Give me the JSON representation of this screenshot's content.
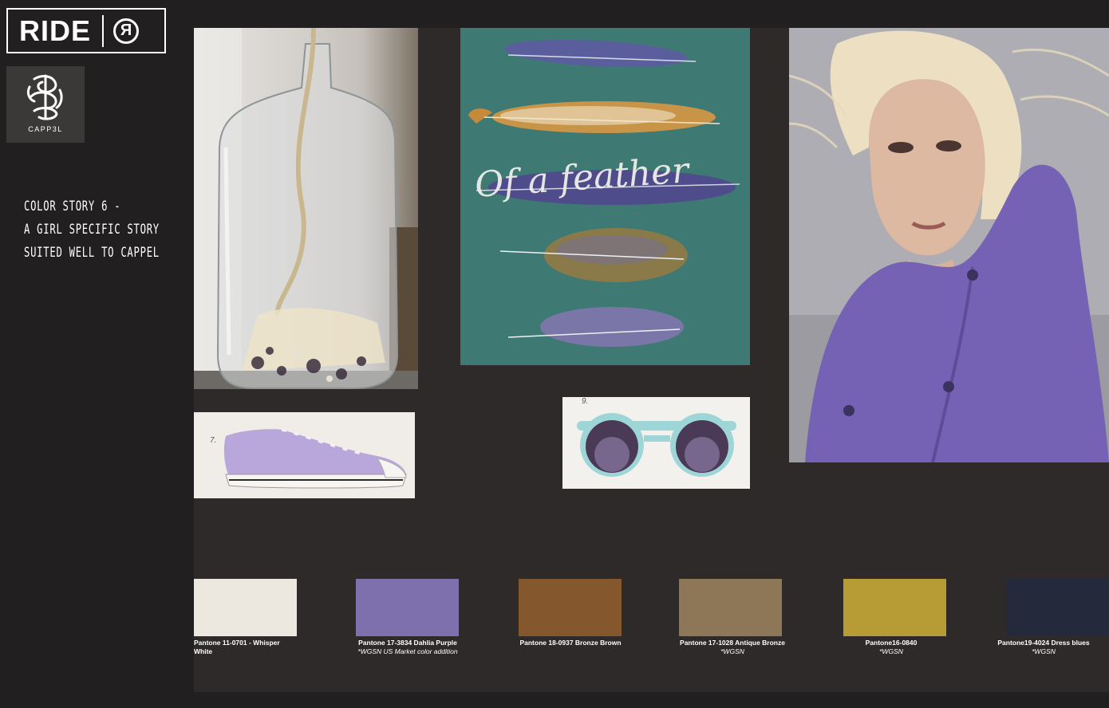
{
  "logos": {
    "ride_word": "RIDE",
    "ride_mark": "R",
    "cappel_name": "CAPP3L"
  },
  "story": {
    "lines": [
      "COLOR STORY  6 -",
      "A GIRL SPECIFIC STORY",
      "SUITED WELL TO CAPPEL"
    ]
  },
  "photos": {
    "feather_script": "Of a feather",
    "shoe_number": "7.",
    "glasses_number": "9."
  },
  "swatches": [
    {
      "color": "#ece7df",
      "label": "Pantone 11-0701 - Whisper White",
      "note": ""
    },
    {
      "color": "#7e6fad",
      "label": "Pantone 17-3834 Dahlia Purple",
      "note": "*WGSN US Market color addition"
    },
    {
      "color": "#84572c",
      "label": "Pantone 18-0937 Bronze Brown",
      "note": ""
    },
    {
      "color": "#8d7757",
      "label": "Pantone 17-1028 Antique Bronze",
      "note": "*WGSN"
    },
    {
      "color": "#b79b35",
      "label": "Pantone16-0840",
      "note": "*WGSN"
    },
    {
      "color": "#242a3c",
      "label": "Pantone19-4024 Dress blues",
      "note": "*WGSN"
    }
  ]
}
